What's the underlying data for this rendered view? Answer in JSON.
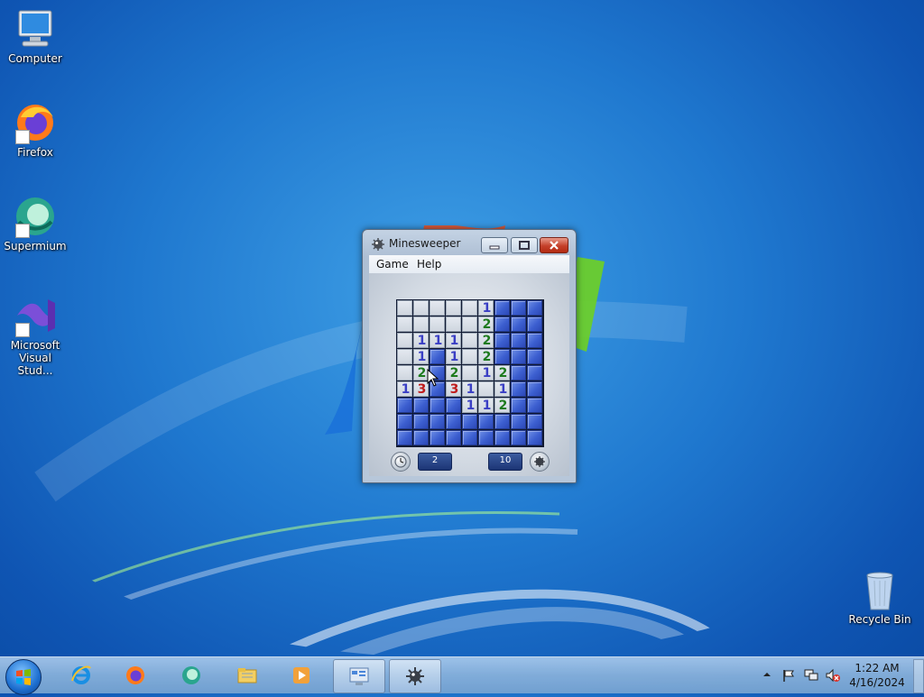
{
  "desktop": {
    "icons": [
      {
        "label": "Computer",
        "icon": "computer-icon"
      },
      {
        "label": "Firefox",
        "icon": "firefox-icon"
      },
      {
        "label": "Supermium",
        "icon": "supermium-icon"
      },
      {
        "label": "Microsoft Visual Stud...",
        "icon": "visual-studio-icon"
      }
    ],
    "recycle_bin": {
      "label": "Recycle Bin",
      "icon": "recycle-bin-icon"
    }
  },
  "window": {
    "title": "Minesweeper",
    "icon": "mine-icon",
    "menu": [
      "Game",
      "Help"
    ],
    "board": {
      "cols": 9,
      "rows": 9,
      "grid": [
        "o o o o o 1 h h h",
        "o o o o o 2 h h h",
        "o 1 1 1 o 2 h h h",
        "o 1 h 1 o 2 h h h",
        "o 2 h 2 o 1 2 h h",
        "1 3 h 3 1 o 1 h h",
        "h h h h 1 1 2 h h",
        "h h h h h h h h h",
        "h h h h h h h h h"
      ],
      "number_colors": {
        "1": "#3a3fc4",
        "2": "#1d7a1d",
        "3": "#c01c1c"
      }
    },
    "timer_value": "2",
    "mines_value": "10",
    "timer_icon": "clock-icon",
    "mines_icon": "mine-icon"
  },
  "taskbar": {
    "start": "windows-start-icon",
    "apps": [
      {
        "name": "internet-explorer-icon",
        "active": false
      },
      {
        "name": "firefox-icon",
        "active": false
      },
      {
        "name": "supermium-icon",
        "active": false
      },
      {
        "name": "file-explorer-icon",
        "active": false
      },
      {
        "name": "media-player-icon",
        "active": false
      },
      {
        "name": "control-panel-icon",
        "active": true
      },
      {
        "name": "minesweeper-icon",
        "active": true
      }
    ],
    "tray": [
      "show-hidden-icons-icon",
      "action-center-flag-icon",
      "network-icon",
      "volume-muted-icon"
    ],
    "time": "1:22 AM",
    "date": "4/16/2024"
  }
}
